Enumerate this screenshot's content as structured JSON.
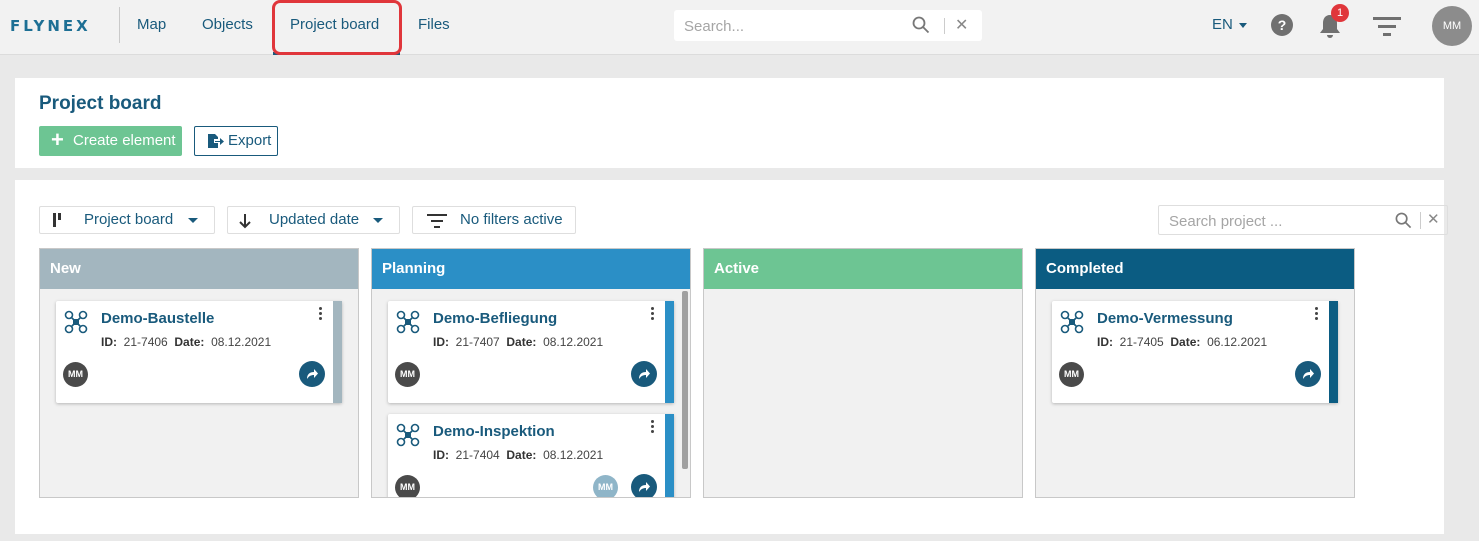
{
  "nav": {
    "logo": "FLYNEX",
    "items": [
      "Map",
      "Objects",
      "Project board",
      "Files"
    ],
    "search_placeholder": "Search...",
    "clear": "✕",
    "lang": "EN",
    "help": "?",
    "notif_count": "1",
    "user_initials": "MM"
  },
  "header": {
    "title": "Project board",
    "create_label": "Create element",
    "export_label": "Export"
  },
  "toolbar": {
    "view_label": "Project board",
    "sort_label": "Updated date",
    "filter_label": "No filters active",
    "search_placeholder": "Search project ...",
    "clear": "✕"
  },
  "columns": [
    {
      "title": "New",
      "color": "#a3b6bf",
      "stripe": "#a3b6bf"
    },
    {
      "title": "Planning",
      "color": "#2b8fc6",
      "stripe": "#2b8fc6"
    },
    {
      "title": "Active",
      "color": "#6dc593",
      "stripe": "#6dc593"
    },
    {
      "title": "Completed",
      "color": "#0b5c82",
      "stripe": "#0b5c82"
    }
  ],
  "cards": {
    "new": [
      {
        "title": "Demo-Baustelle",
        "id_label": "ID:",
        "id": "21-7406",
        "date_label": "Date:",
        "date": "08.12.2021",
        "avatar": "MM"
      }
    ],
    "planning": [
      {
        "title": "Demo-Befliegung",
        "id_label": "ID:",
        "id": "21-7407",
        "date_label": "Date:",
        "date": "08.12.2021",
        "avatar": "MM"
      },
      {
        "title": "Demo-Inspektion",
        "id_label": "ID:",
        "id": "21-7404",
        "date_label": "Date:",
        "date": "08.12.2021",
        "avatar": "MM",
        "avatar2": "MM"
      }
    ],
    "completed": [
      {
        "title": "Demo-Vermessung",
        "id_label": "ID:",
        "id": "21-7405",
        "date_label": "Date:",
        "date": "06.12.2021",
        "avatar": "MM"
      }
    ]
  },
  "icons": {
    "search": "search-icon",
    "bell": "bell-icon",
    "filter": "filter-icon",
    "drone": "drone-icon",
    "open": "share-arrow-icon",
    "more": "kebab-icon"
  }
}
